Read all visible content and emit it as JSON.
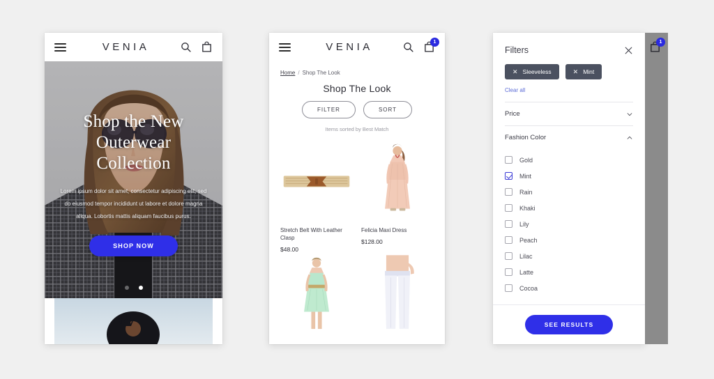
{
  "canvas": {
    "background": "#f0f0f0",
    "accent": "#2f2fe8",
    "chip_bg": "#4b5160",
    "scrim": "#8b8b8b"
  },
  "brand": "VENIA",
  "icons": {
    "menu": "hamburger-icon",
    "search": "search-icon",
    "cart": "cart-icon",
    "close": "close-icon",
    "chevron_down": "chevron-down-icon",
    "chevron_up": "chevron-up-icon"
  },
  "phone1": {
    "header": {
      "brand": "VENIA",
      "cart_count": ""
    },
    "hero": {
      "title_lines": [
        "Shop the New",
        "Outerwear",
        "Collection"
      ],
      "subtitle": "Lorem ipsum dolor sit amet, consectetur adipiscing elit, sed do eiusmod tempor incididunt ut labore et dolore magna aliqua. Lobortis mattis aliquam faucibus purus.",
      "cta_label": "SHOP NOW",
      "dots": 2,
      "active_dot": 1
    }
  },
  "phone2": {
    "header": {
      "brand": "VENIA",
      "cart_count": "1"
    },
    "breadcrumb": {
      "home": "Home",
      "separator": "/",
      "current": "Shop The Look"
    },
    "page_title": "Shop The Look",
    "buttons": {
      "filter": "FILTER",
      "sort": "SORT"
    },
    "sorted_by": "Items sorted by Best Match",
    "products": [
      {
        "name": "Stretch Belt With Leather Clasp",
        "price": "$48.00",
        "image": "straw-belt"
      },
      {
        "name": "Felicia Maxi Dress",
        "price": "$128.00",
        "image": "peach-maxi-dress"
      },
      {
        "name": "",
        "price": "",
        "image": "mint-dress"
      },
      {
        "name": "",
        "price": "",
        "image": "white-pants"
      }
    ]
  },
  "phone3": {
    "title": "Filters",
    "active_chips": [
      {
        "label": "Sleeveless"
      },
      {
        "label": "Mint"
      }
    ],
    "clear_all": "Clear all",
    "sections": [
      {
        "label": "Price",
        "expanded": false
      },
      {
        "label": "Fashion Color",
        "expanded": true
      }
    ],
    "color_options": [
      {
        "label": "Gold",
        "checked": false
      },
      {
        "label": "Mint",
        "checked": true
      },
      {
        "label": "Rain",
        "checked": false
      },
      {
        "label": "Khaki",
        "checked": false
      },
      {
        "label": "Lily",
        "checked": false
      },
      {
        "label": "Peach",
        "checked": false
      },
      {
        "label": "Lilac",
        "checked": false
      },
      {
        "label": "Latte",
        "checked": false
      },
      {
        "label": "Cocoa",
        "checked": false
      }
    ],
    "see_results": "SEE RESULTS",
    "scrim_cart_count": "1"
  }
}
